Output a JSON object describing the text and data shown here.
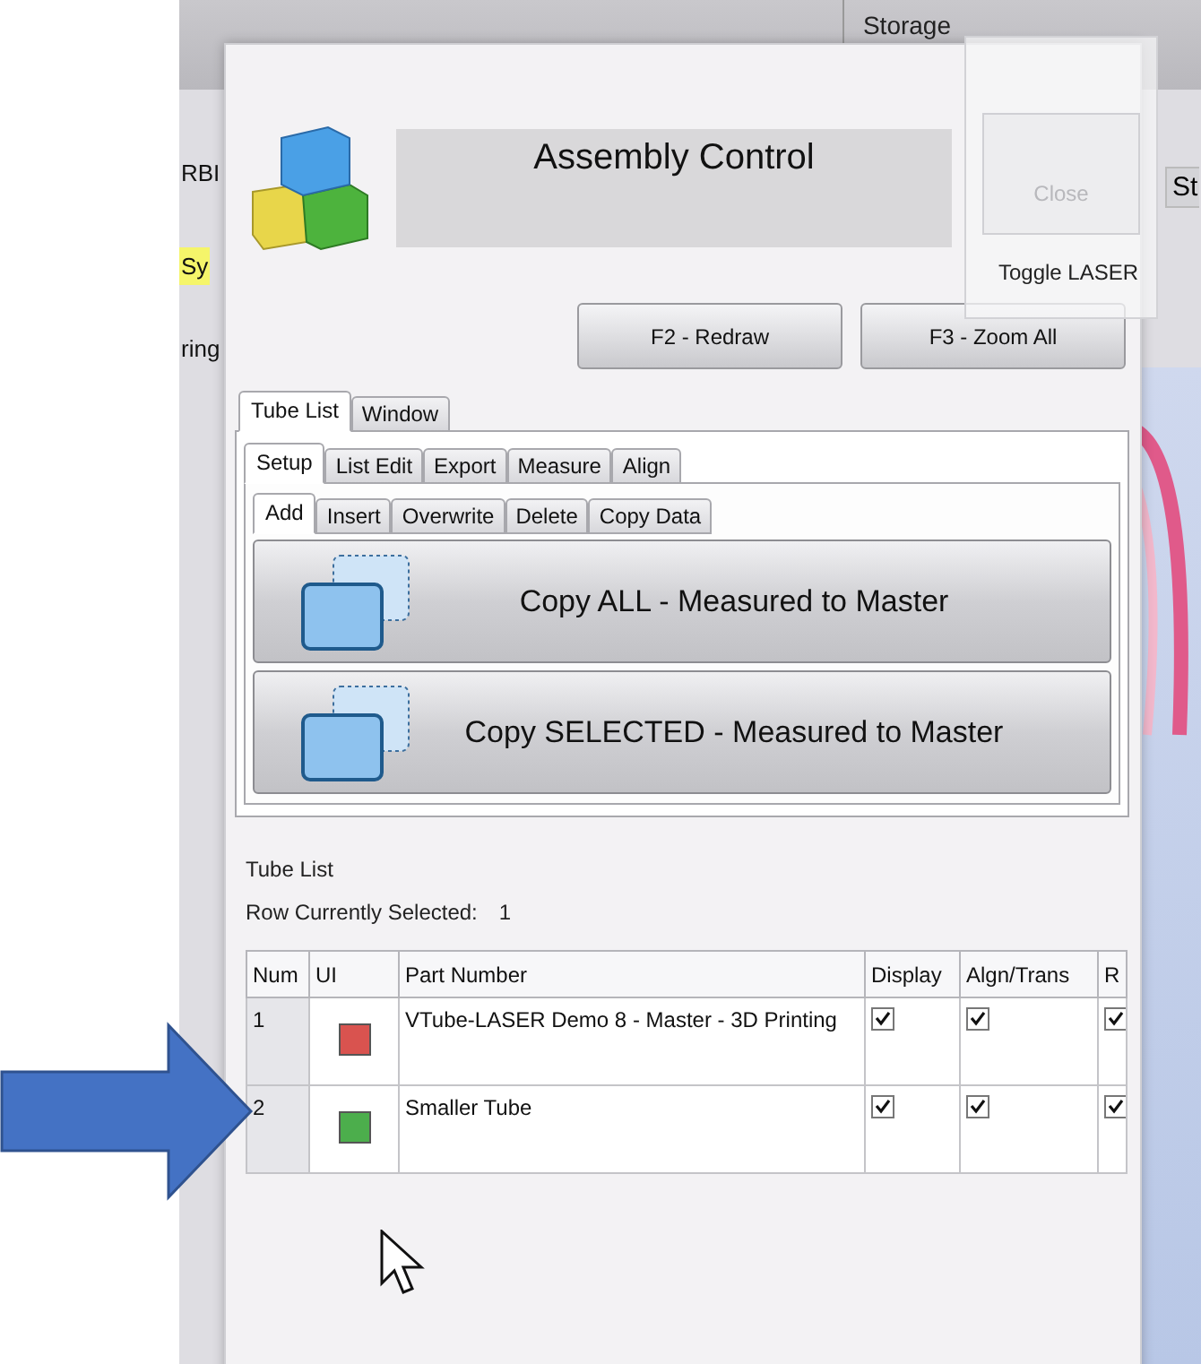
{
  "background_app": {
    "toolbar_tabs": [
      "Storage"
    ],
    "side_labels": [
      {
        "text": "RBI",
        "highlighted": false
      },
      {
        "text": "Sy",
        "highlighted": true
      },
      {
        "text": "ring",
        "highlighted": false
      }
    ],
    "right_label": "St"
  },
  "laser_panel": {
    "close_button": {
      "label": "Close",
      "disabled": true
    },
    "toggle_label": "Toggle LASER"
  },
  "dialog": {
    "title": "Assembly Control",
    "buttons": [
      "F2 - Redraw",
      "F3 - Zoom All"
    ],
    "tabs": [
      {
        "label": "Tube List",
        "selected": true
      },
      {
        "label": "Window",
        "selected": false
      }
    ],
    "subtabs": [
      {
        "label": "Setup",
        "selected": true
      },
      {
        "label": "List Edit",
        "selected": false
      },
      {
        "label": "Export",
        "selected": false
      },
      {
        "label": "Measure",
        "selected": false
      },
      {
        "label": "Align",
        "selected": false
      }
    ],
    "action_tabs": [
      {
        "label": "Add",
        "selected": true
      },
      {
        "label": "Insert",
        "selected": false
      },
      {
        "label": "Overwrite",
        "selected": false
      },
      {
        "label": "Delete",
        "selected": false
      },
      {
        "label": "Copy Data",
        "selected": false
      }
    ],
    "actions": [
      "Copy ALL - Measured to Master",
      "Copy SELECTED - Measured to Master"
    ],
    "list_title": "Tube List",
    "selection": {
      "label": "Row Currently Selected:",
      "value": "1"
    },
    "table": {
      "columns": [
        "Num",
        "UI",
        "Part Number",
        "Display",
        "Algn/Trans",
        "R"
      ],
      "rows": [
        {
          "num": "1",
          "color": "#d9534f",
          "part_number": "VTube-LASER Demo 8 - Master - 3D Printing",
          "display": true,
          "align": true,
          "column_6": true
        },
        {
          "num": "2",
          "color": "#4cae4c",
          "part_number": "Smaller Tube",
          "display": true,
          "align": true,
          "column_6": true
        }
      ]
    }
  }
}
